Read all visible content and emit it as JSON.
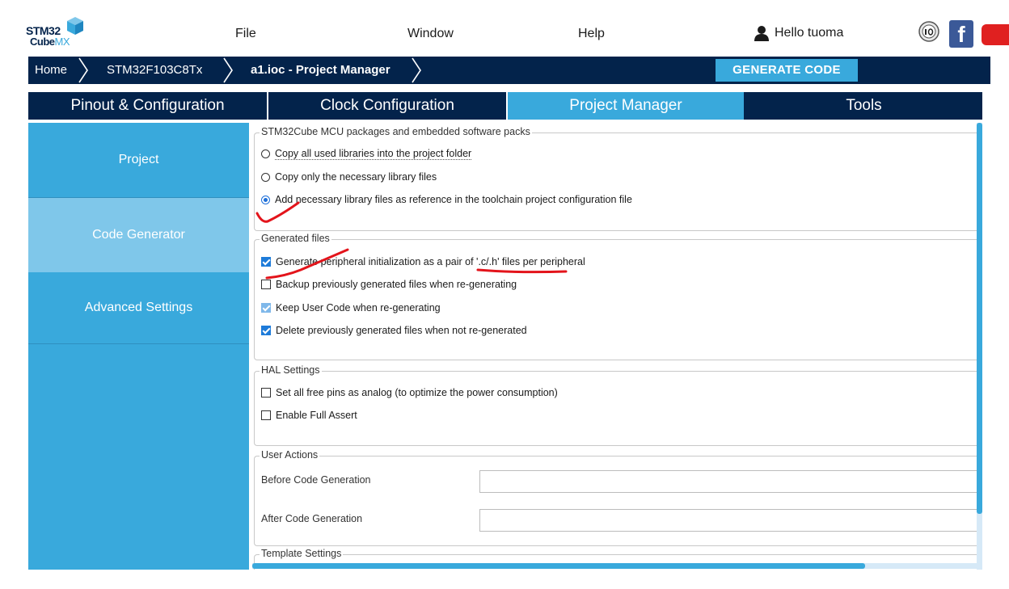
{
  "app": {
    "logo_top": "STM32",
    "logo_bottom_a": "Cube",
    "logo_bottom_b": "MX"
  },
  "menu": {
    "file": "File",
    "window": "Window",
    "help": "Help",
    "user": "Hello tuoma"
  },
  "social": {
    "facebook": "f"
  },
  "breadcrumb": {
    "home": "Home",
    "device": "STM32F103C8Tx",
    "project": "a1.ioc - Project Manager",
    "generate": "GENERATE CODE"
  },
  "tabs": [
    {
      "label": "Pinout & Configuration"
    },
    {
      "label": "Clock Configuration"
    },
    {
      "label": "Project Manager",
      "active": true
    },
    {
      "label": "Tools"
    }
  ],
  "sidebar": {
    "items": [
      {
        "label": "Project"
      },
      {
        "label": "Code Generator",
        "active": true
      },
      {
        "label": "Advanced Settings"
      }
    ]
  },
  "packages": {
    "legend": "STM32Cube MCU packages and embedded software packs",
    "options": [
      {
        "label": "Copy all used libraries into the project folder",
        "selected": false
      },
      {
        "label": "Copy only the necessary library files",
        "selected": false
      },
      {
        "label": "Add necessary library files as reference in the toolchain project configuration file",
        "selected": true
      }
    ]
  },
  "generated": {
    "legend": "Generated files",
    "options": [
      {
        "label": "Generate peripheral initialization as a pair of '.c/.h' files per peripheral",
        "checked": true
      },
      {
        "label": "Backup previously generated files when re-generating",
        "checked": false
      },
      {
        "label": "Keep User Code when re-generating",
        "checked": true
      },
      {
        "label": "Delete previously generated files when not re-generated",
        "checked": true
      }
    ]
  },
  "hal": {
    "legend": "HAL Settings",
    "options": [
      {
        "label": "Set all free pins as analog (to optimize the power consumption)",
        "checked": false
      },
      {
        "label": "Enable Full Assert",
        "checked": false
      }
    ]
  },
  "user_actions": {
    "legend": "User Actions",
    "before_label": "Before Code Generation",
    "before_value": "",
    "after_label": "After Code Generation",
    "after_value": ""
  },
  "template": {
    "legend": "Template Settings"
  },
  "colors": {
    "navy": "#03234b",
    "accent": "#39a9dc",
    "active_sidebar": "#7fc7ea",
    "annotation": "#e3141b"
  }
}
